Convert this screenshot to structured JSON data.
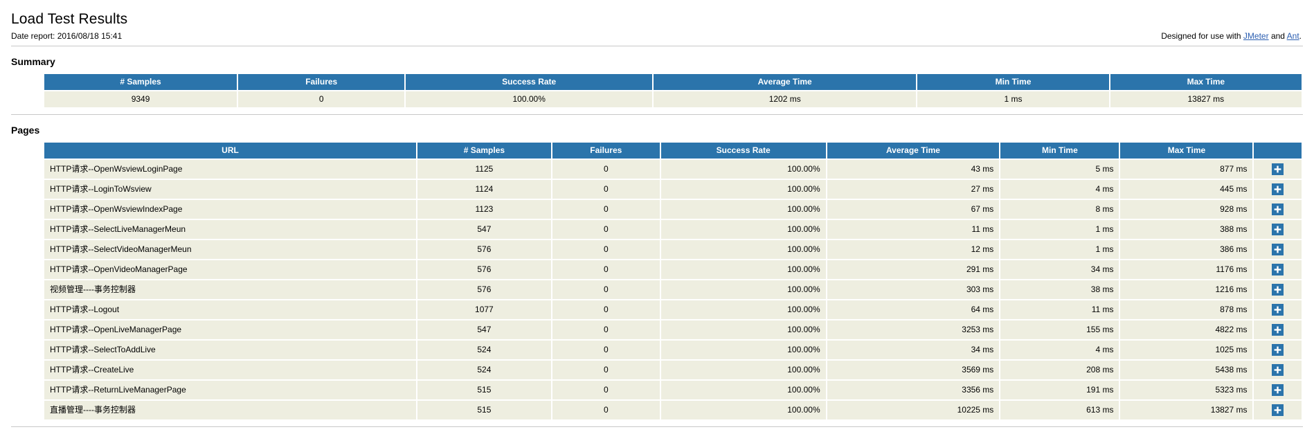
{
  "header": {
    "title": "Load Test Results",
    "date_report": "Date report: 2016/08/18 15:41",
    "designed_prefix": "Designed for use with ",
    "jmeter_link": "JMeter",
    "designed_conjunction": " and ",
    "ant_link": "Ant",
    "designed_suffix": "."
  },
  "colors": {
    "table_header_bg": "#2b74ab",
    "table_row_bg": "#eeeee0",
    "link": "#2a5db0",
    "page_bg": "#ffffff"
  },
  "summary": {
    "section_title": "Summary",
    "columns": [
      "# Samples",
      "Failures",
      "Success Rate",
      "Average Time",
      "Min Time",
      "Max Time"
    ],
    "rows": [
      {
        "samples": "9349",
        "failures": "0",
        "success_rate": "100.00%",
        "average_time": "1202 ms",
        "min_time": "1 ms",
        "max_time": "13827 ms"
      }
    ]
  },
  "pages": {
    "section_title": "Pages",
    "columns": [
      "URL",
      "# Samples",
      "Failures",
      "Success Rate",
      "Average Time",
      "Min Time",
      "Max Time",
      ""
    ],
    "expand_icon": "plus-icon",
    "rows": [
      {
        "url": "HTTP请求--OpenWsviewLoginPage",
        "samples": "1125",
        "failures": "0",
        "success_rate": "100.00%",
        "average_time": "43 ms",
        "min_time": "5 ms",
        "max_time": "877 ms"
      },
      {
        "url": "HTTP请求--LoginToWsview",
        "samples": "1124",
        "failures": "0",
        "success_rate": "100.00%",
        "average_time": "27 ms",
        "min_time": "4 ms",
        "max_time": "445 ms"
      },
      {
        "url": "HTTP请求--OpenWsviewIndexPage",
        "samples": "1123",
        "failures": "0",
        "success_rate": "100.00%",
        "average_time": "67 ms",
        "min_time": "8 ms",
        "max_time": "928 ms"
      },
      {
        "url": "HTTP请求--SelectLiveManagerMeun",
        "samples": "547",
        "failures": "0",
        "success_rate": "100.00%",
        "average_time": "11 ms",
        "min_time": "1 ms",
        "max_time": "388 ms"
      },
      {
        "url": "HTTP请求--SelectVideoManagerMeun",
        "samples": "576",
        "failures": "0",
        "success_rate": "100.00%",
        "average_time": "12 ms",
        "min_time": "1 ms",
        "max_time": "386 ms"
      },
      {
        "url": "HTTP请求--OpenVideoManagerPage",
        "samples": "576",
        "failures": "0",
        "success_rate": "100.00%",
        "average_time": "291 ms",
        "min_time": "34 ms",
        "max_time": "1176 ms"
      },
      {
        "url": "视频管理----事务控制器",
        "samples": "576",
        "failures": "0",
        "success_rate": "100.00%",
        "average_time": "303 ms",
        "min_time": "38 ms",
        "max_time": "1216 ms"
      },
      {
        "url": "HTTP请求--Logout",
        "samples": "1077",
        "failures": "0",
        "success_rate": "100.00%",
        "average_time": "64 ms",
        "min_time": "11 ms",
        "max_time": "878 ms"
      },
      {
        "url": "HTTP请求--OpenLiveManagerPage",
        "samples": "547",
        "failures": "0",
        "success_rate": "100.00%",
        "average_time": "3253 ms",
        "min_time": "155 ms",
        "max_time": "4822 ms"
      },
      {
        "url": "HTTP请求--SelectToAddLive",
        "samples": "524",
        "failures": "0",
        "success_rate": "100.00%",
        "average_time": "34 ms",
        "min_time": "4 ms",
        "max_time": "1025 ms"
      },
      {
        "url": "HTTP请求--CreateLive",
        "samples": "524",
        "failures": "0",
        "success_rate": "100.00%",
        "average_time": "3569 ms",
        "min_time": "208 ms",
        "max_time": "5438 ms"
      },
      {
        "url": "HTTP请求--ReturnLiveManagerPage",
        "samples": "515",
        "failures": "0",
        "success_rate": "100.00%",
        "average_time": "3356 ms",
        "min_time": "191 ms",
        "max_time": "5323 ms"
      },
      {
        "url": "直播管理----事务控制器",
        "samples": "515",
        "failures": "0",
        "success_rate": "100.00%",
        "average_time": "10225 ms",
        "min_time": "613 ms",
        "max_time": "13827 ms"
      }
    ]
  }
}
